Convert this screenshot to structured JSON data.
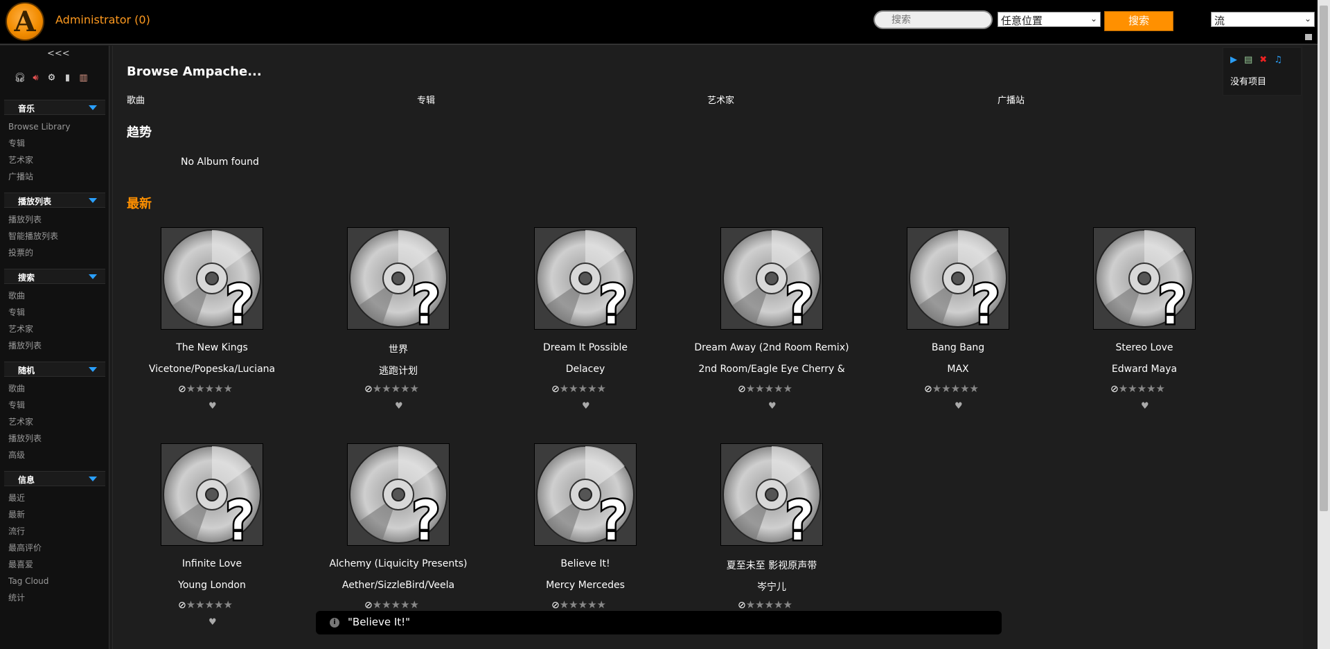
{
  "header": {
    "logo_letter": "A",
    "user_label": "Administrator (0)",
    "search_placeholder": "搜索",
    "search_scope": "任意位置",
    "search_button": "搜索",
    "play_type": "流"
  },
  "sidebar": {
    "collapse": "<<<",
    "icons": [
      "headphones-icon",
      "speaker-icon",
      "settings-icon",
      "mobile-icon",
      "logout-icon"
    ],
    "sections": [
      {
        "title": "音乐",
        "items": [
          "Browse Library",
          "专辑",
          "艺术家",
          "广播站"
        ]
      },
      {
        "title": "播放列表",
        "items": [
          "播放列表",
          "智能播放列表",
          "投票的"
        ]
      },
      {
        "title": "搜索",
        "items": [
          "歌曲",
          "专辑",
          "艺术家",
          "播放列表"
        ]
      },
      {
        "title": "随机",
        "items": [
          "歌曲",
          "专辑",
          "艺术家",
          "播放列表",
          "高级"
        ]
      },
      {
        "title": "信息",
        "items": [
          "最近",
          "最新",
          "流行",
          "最高评价",
          "最喜爱",
          "Tag Cloud",
          "统计"
        ]
      }
    ]
  },
  "main": {
    "browse_title": "Browse Ampache...",
    "browse_links": [
      "歌曲",
      "专辑",
      "艺术家",
      "广播站"
    ],
    "trending_title": "趋势",
    "no_album": "No Album found",
    "newest_title": "最新",
    "albums": [
      {
        "title": "The New Kings",
        "artist": "Vicetone/Popeska/Luciana"
      },
      {
        "title": "世界",
        "artist": "逃跑计划"
      },
      {
        "title": "Dream It Possible",
        "artist": "Delacey"
      },
      {
        "title": "Dream Away (2nd Room Remix)",
        "artist": "2nd Room/Eagle Eye Cherry &"
      },
      {
        "title": "Bang Bang",
        "artist": "MAX"
      },
      {
        "title": "Stereo Love",
        "artist": "Edward Maya"
      },
      {
        "title": "Infinite Love",
        "artist": "Young London"
      },
      {
        "title": "Alchemy (Liquicity Presents)",
        "artist": "Aether/SizzleBird/Veela"
      },
      {
        "title": "Believe It!",
        "artist": "Mercy Mercedes"
      },
      {
        "title": "夏至未至 影视原声带",
        "artist": "岑宁儿"
      }
    ],
    "rating_symbols": {
      "no_rating": "⊘",
      "stars": "★★★★★",
      "favorite": "♥"
    }
  },
  "rightbar": {
    "icons": [
      "play-icon",
      "add-playlist-icon",
      "clear-icon",
      "add-to-playlist-icon"
    ],
    "empty_text": "没有项目"
  },
  "toast": {
    "text": "\"Believe It!\""
  },
  "colors": {
    "accent": "#ff9000",
    "link_accent": "#ff9a1f",
    "sidebar_arrow": "#2aa0ff"
  }
}
